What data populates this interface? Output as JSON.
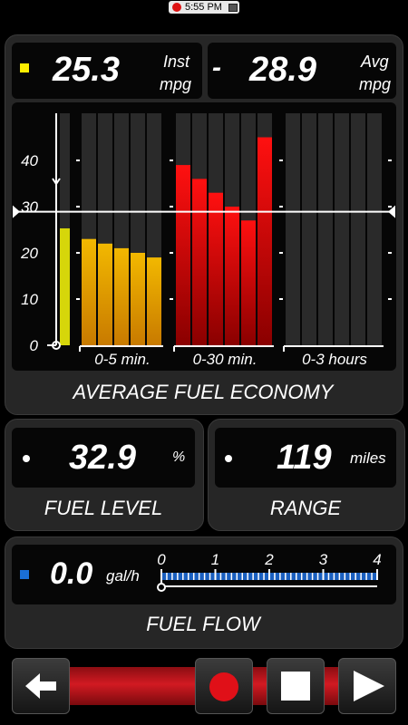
{
  "status_bar": {
    "time": "5:55 PM"
  },
  "top": {
    "inst_value": "25.3",
    "inst_label_1": "Inst",
    "inst_label_2": "mpg",
    "separator": "-",
    "avg_value": "28.9",
    "avg_label_1": "Avg",
    "avg_label_2": "mpg"
  },
  "chart_data": {
    "type": "bar",
    "title": "AVERAGE FUEL ECONOMY",
    "ylim": [
      0,
      50
    ],
    "yticks": [
      "0",
      "10",
      "20",
      "30",
      "40"
    ],
    "reference_line": 28.9,
    "current_bar": {
      "value": 25.3,
      "color": "#d6d60a"
    },
    "groups": [
      {
        "label": "0-5 min.",
        "values": [
          23,
          22,
          21,
          20,
          19
        ],
        "color": "#e0a000"
      },
      {
        "label": "0-30 min.",
        "values": [
          39,
          36,
          33,
          30,
          27,
          45
        ],
        "color": "#dd0000"
      },
      {
        "label": "0-3 hours",
        "values": [],
        "color": "#888888"
      }
    ]
  },
  "fuel_level": {
    "value": "32.9",
    "unit": "%",
    "label": "FUEL LEVEL"
  },
  "range": {
    "value": "119",
    "unit": "miles",
    "label": "RANGE"
  },
  "fuel_flow": {
    "value": "0.0",
    "unit": "gal/h",
    "label": "FUEL FLOW",
    "scale": [
      "0",
      "1",
      "2",
      "3",
      "4"
    ],
    "level": 0.0
  },
  "controls": {
    "back_icon": "arrow-left-icon",
    "record_icon": "record-icon",
    "stop_icon": "stop-icon",
    "play_icon": "play-icon"
  },
  "colors": {
    "inst_marker": "#ffee00",
    "flow_marker": "#1a6fd6",
    "flow_bar": "#1a5fbf",
    "bottom_strip": "#c0151c"
  }
}
